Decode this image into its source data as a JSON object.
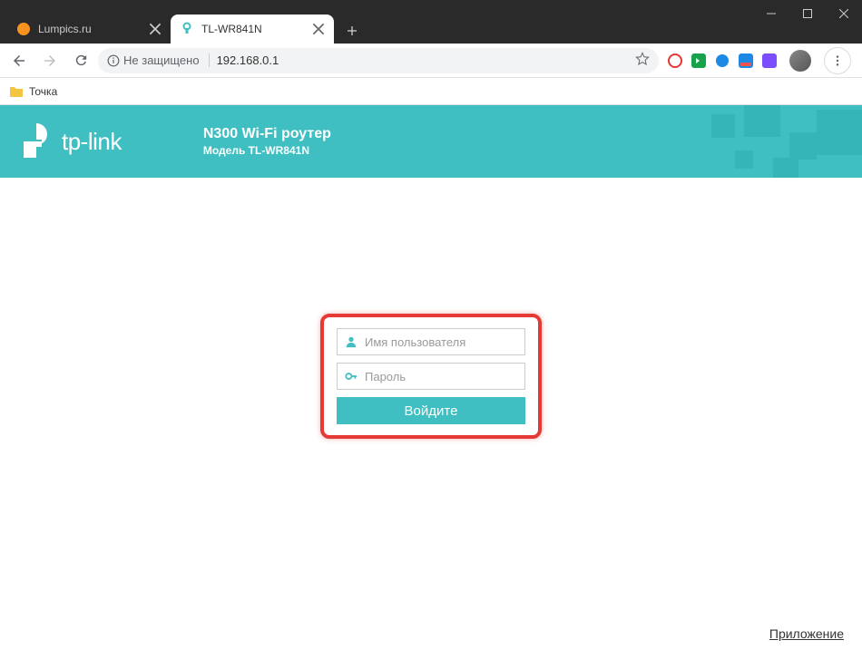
{
  "window": {
    "tabs": [
      {
        "title": "Lumpics.ru",
        "active": false
      },
      {
        "title": "TL-WR841N",
        "active": true
      }
    ],
    "security_label": "Не защищено",
    "url": "192.168.0.1",
    "bookmarks": [
      {
        "label": "Точка"
      }
    ]
  },
  "router": {
    "brand": "tp-link",
    "title": "N300 Wi-Fi роутер",
    "model": "Модель TL-WR841N"
  },
  "login": {
    "username_placeholder": "Имя пользователя",
    "password_placeholder": "Пароль",
    "submit_label": "Войдите"
  },
  "footer": {
    "app_link": "Приложение"
  },
  "colors": {
    "accent": "#3fbfc1",
    "highlight": "#e53935"
  }
}
